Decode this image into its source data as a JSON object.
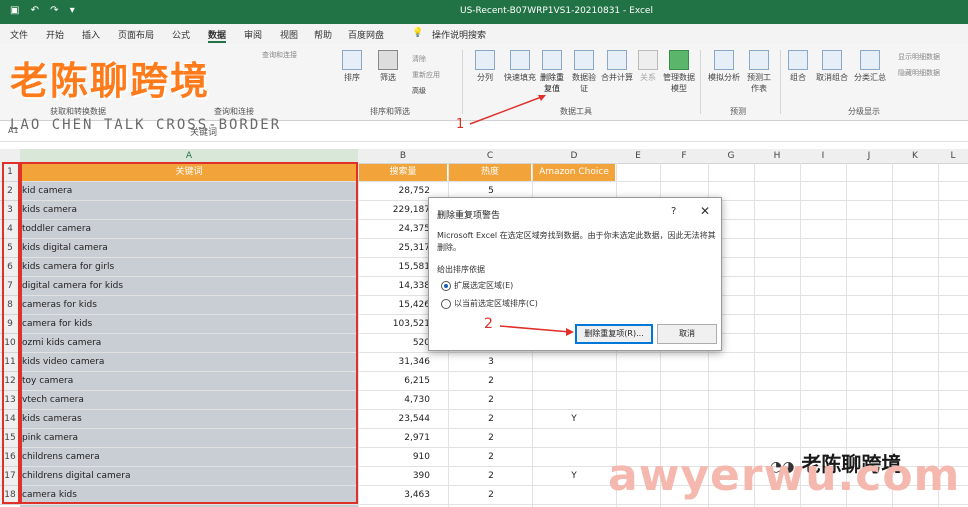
{
  "title_bar": {
    "quick_access": "▣ ↶ ↷ ▾",
    "document": "US-Recent-B07WRP1VS1-20210831  -  Excel"
  },
  "menu": [
    "文件",
    "开始",
    "插入",
    "页面布局",
    "公式",
    "数据",
    "审阅",
    "视图",
    "帮助",
    "百度网盘"
  ],
  "menu_search": "操作说明搜索",
  "ribbon": {
    "sort_filter": [
      "排序",
      "筛选",
      "清除",
      "重新应用",
      "高级"
    ],
    "sort_filter_group": "排序和筛选",
    "data_tools": [
      "分列",
      "快速填充",
      "删除重复值",
      "数据验证",
      "合并计算",
      "关系",
      "管理数据模型"
    ],
    "data_tools_group": "数据工具",
    "forecast": [
      "模拟分析",
      "预测工作表"
    ],
    "forecast_group": "预测",
    "outline": [
      "组合",
      "取消组合",
      "分类汇总"
    ],
    "outline_group": "分级显示",
    "outline_small": [
      "显示明细数据",
      "隐藏明细数据"
    ],
    "get_data_group": "获取和转换数据",
    "queries_group": "查询和连接"
  },
  "watermark": {
    "logo": "老陈聊跨境",
    "subtitle": "LAO CHEN TALK CROSS-BORDER",
    "bottom_brand": "老陈聊跨境",
    "bottom_site": "awyerwu.com"
  },
  "formula_bar": {
    "cell_ref": "A1",
    "value": "关键词"
  },
  "columns": [
    "A",
    "B",
    "C",
    "D",
    "E",
    "F",
    "G",
    "H",
    "I",
    "J",
    "K",
    "L"
  ],
  "headers": {
    "A": "关键词",
    "B": "搜索量",
    "C": "热度",
    "D": "Amazon Choice"
  },
  "rows": [
    {
      "n": "1"
    },
    {
      "n": "2",
      "kw": "kid camera",
      "vol": "28,752",
      "heat": "5",
      "ac": ""
    },
    {
      "n": "3",
      "kw": "kids camera",
      "vol": "229,187",
      "heat": "",
      "ac": ""
    },
    {
      "n": "4",
      "kw": "toddler camera",
      "vol": "24,375",
      "heat": "",
      "ac": ""
    },
    {
      "n": "5",
      "kw": "kids digital camera",
      "vol": "25,317",
      "heat": "",
      "ac": ""
    },
    {
      "n": "6",
      "kw": "kids camera for girls",
      "vol": "15,581",
      "heat": "",
      "ac": ""
    },
    {
      "n": "7",
      "kw": "digital camera for kids",
      "vol": "14,338",
      "heat": "",
      "ac": ""
    },
    {
      "n": "8",
      "kw": "cameras for kids",
      "vol": "15,426",
      "heat": "",
      "ac": ""
    },
    {
      "n": "9",
      "kw": "camera for kids",
      "vol": "103,521",
      "heat": "",
      "ac": ""
    },
    {
      "n": "10",
      "kw": "ozmi kids camera",
      "vol": "520",
      "heat": "",
      "ac": ""
    },
    {
      "n": "11",
      "kw": "kids video camera",
      "vol": "31,346",
      "heat": "3",
      "ac": ""
    },
    {
      "n": "12",
      "kw": "toy camera",
      "vol": "6,215",
      "heat": "2",
      "ac": ""
    },
    {
      "n": "13",
      "kw": "vtech camera",
      "vol": "4,730",
      "heat": "2",
      "ac": ""
    },
    {
      "n": "14",
      "kw": "kids cameras",
      "vol": "23,544",
      "heat": "2",
      "ac": "Y"
    },
    {
      "n": "15",
      "kw": "pink camera",
      "vol": "2,971",
      "heat": "2",
      "ac": ""
    },
    {
      "n": "16",
      "kw": "childrens camera",
      "vol": "910",
      "heat": "2",
      "ac": ""
    },
    {
      "n": "17",
      "kw": "childrens digital camera",
      "vol": "390",
      "heat": "2",
      "ac": "Y"
    },
    {
      "n": "18",
      "kw": "camera kids",
      "vol": "3,463",
      "heat": "2",
      "ac": ""
    }
  ],
  "dialog": {
    "title": "删除重复项警告",
    "help": "?",
    "close": "✕",
    "message": "Microsoft Excel 在选定区域旁找到数据。由于你未选定此数据，因此无法将其删除。",
    "prompt": "给出排序依据",
    "option1": "扩展选定区域(E)",
    "option2": "以当前选定区域排序(C)",
    "primary_button": "删除重复项(R)...",
    "cancel_button": "取消"
  },
  "annotations": {
    "one": "1",
    "two": "2"
  },
  "colors": {
    "excel_green": "#217346",
    "header_orange": "#f2a33a",
    "annotation_red": "#e0302a"
  }
}
